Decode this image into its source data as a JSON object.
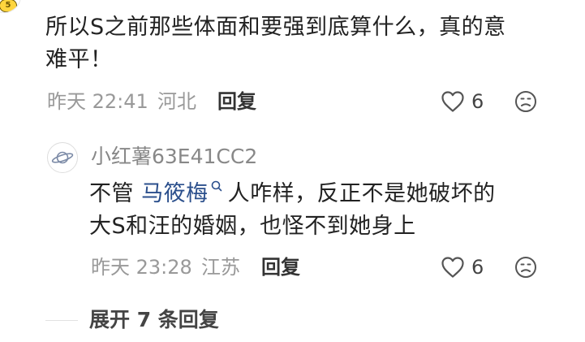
{
  "top_avatar": {
    "badge_text": "5"
  },
  "main_comment": {
    "text_line1": "所以S之前那些体面和要强到底算什么，真的意",
    "text_line2": "难平！",
    "time": "昨天 22:41",
    "location": "河北",
    "reply_label": "回复",
    "like_count": "6"
  },
  "reply_comment": {
    "username": "小红薯63E41CC2",
    "text_prefix": "不管 ",
    "mention": "马筱梅",
    "text_after_mention": "人咋样，反正不是她破坏的",
    "text_line2": "大S和汪的婚姻，也怪不到她身上",
    "time": "昨天 23:28",
    "location": "江苏",
    "reply_label": "回复",
    "like_count": "6"
  },
  "expand_label": "展开 7 条回复",
  "icons": {
    "like": "heart-outline-icon",
    "emoji": "sad-face-icon",
    "mention_search": "search-icon",
    "avatar": "planet-icon"
  },
  "colors": {
    "mention": "#2b4f8c",
    "meta_gray": "#999999",
    "text": "#222222"
  }
}
